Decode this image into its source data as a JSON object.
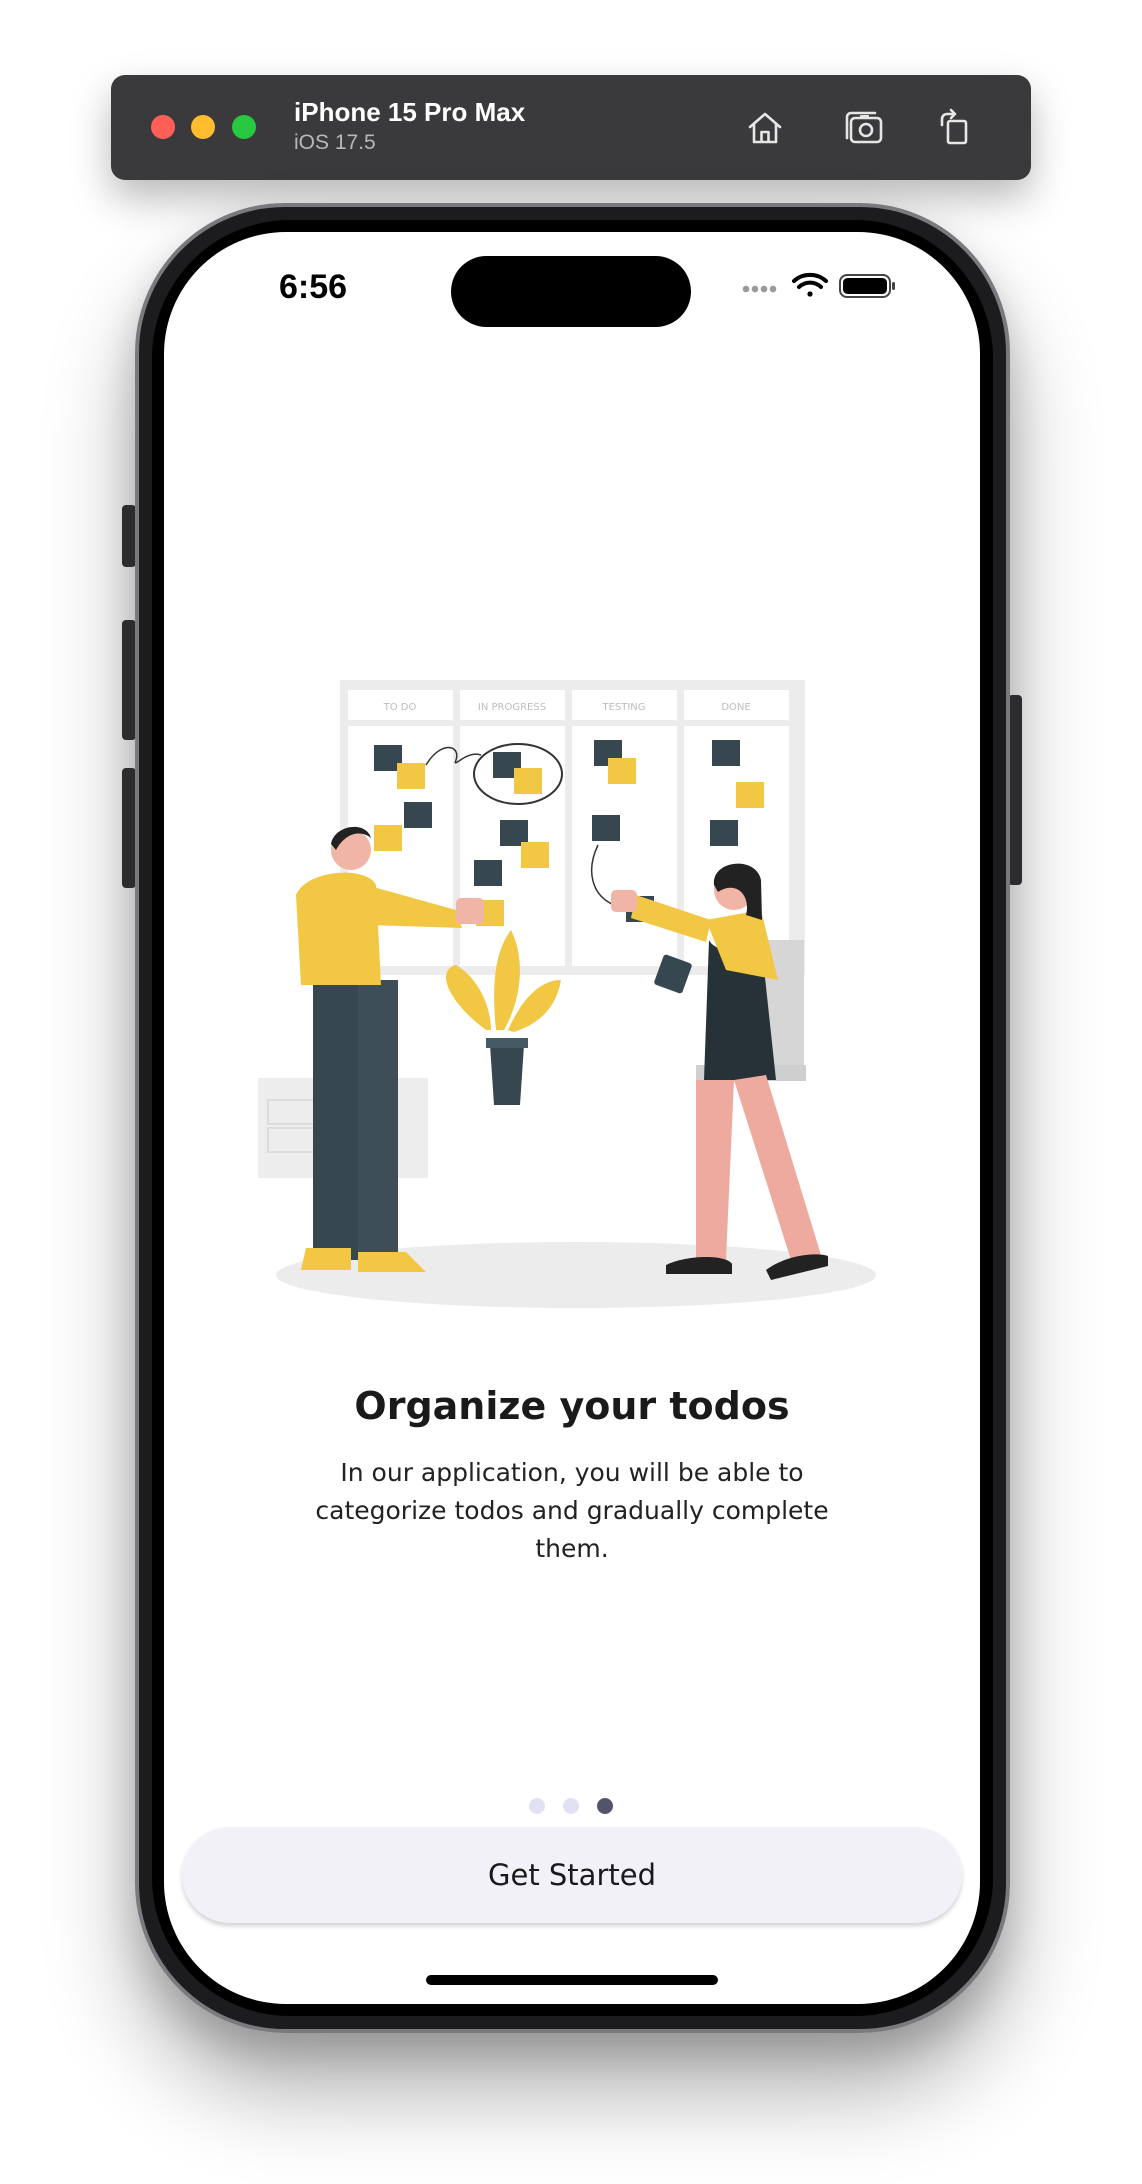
{
  "simulator": {
    "device_name": "iPhone 15 Pro Max",
    "os_version": "iOS 17.5",
    "toolbar_icons": [
      "home-icon",
      "screenshot-icon",
      "rotate-icon"
    ]
  },
  "status_bar": {
    "time": "6:56",
    "icons": [
      "cellular-signal-icon",
      "wifi-icon",
      "battery-icon"
    ]
  },
  "onboarding": {
    "illustration": {
      "description_icon": "kanban-board-illustration",
      "board_columns": [
        "TO DO",
        "IN PROGRESS",
        "TESTING",
        "DONE"
      ]
    },
    "title": "Organize your todos",
    "description": "In our application, you will be able to categorize todos and gradually complete them.",
    "page_indicator": {
      "total": 3,
      "current": 3
    },
    "cta_label": "Get Started"
  },
  "colors": {
    "accent_yellow": "#f2c744",
    "dark_slate": "#37474f",
    "active_dot": "#53536b",
    "inactive_dot": "#e2e1f3",
    "button_bg": "#f2f1f8"
  }
}
